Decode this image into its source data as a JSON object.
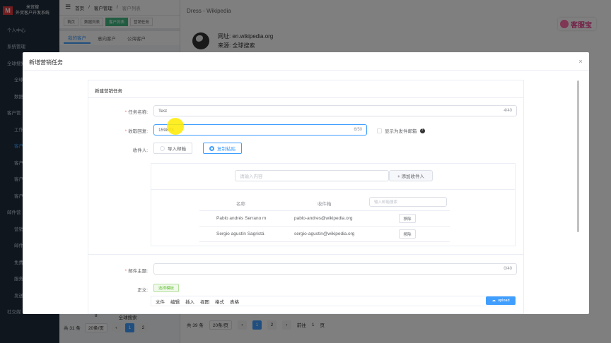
{
  "sidebar": {
    "logo_mark": "M",
    "logo_line1": "米贸搜",
    "logo_line2": "外贸客户开发系统",
    "items": [
      "个人中心",
      "系统管理",
      "全球搜索",
      "全球",
      "数据",
      "客户管",
      "工作",
      "客户",
      "客户",
      "客户",
      "客户",
      "邮件营",
      "营销",
      "邮件",
      "免费",
      "服务",
      "发送",
      "社交媒"
    ]
  },
  "topbar": {
    "breadcrumb": [
      "首页",
      "客户管理",
      "客户列表"
    ]
  },
  "tags": [
    "首页",
    "数据列表",
    "客户列表",
    "营销任务"
  ],
  "subtabs": [
    "我的客户",
    "意向客户",
    "公海客户"
  ],
  "pager_left": {
    "total": "共 31 条",
    "size": "20条/页",
    "pages": [
      "1",
      "2"
    ],
    "row_num": "8",
    "row_text": "全球搜索"
  },
  "drawer": {
    "title": "Dress - Wikipedia",
    "url_line": "网址: en.wikipedia.org",
    "source_line": "来源: 全球搜索"
  },
  "brand": {
    "text": "客服宝"
  },
  "pager_right": {
    "total": "共 39 条",
    "size": "20条/页",
    "pages": [
      "1",
      "2"
    ],
    "goto": "前往",
    "goto_val": "1",
    "page_unit": "页"
  },
  "modal": {
    "title": "新增营销任务",
    "close": "×",
    "card_title": "新建营销任务",
    "task_name": {
      "label": "任务名称:",
      "value": "Test",
      "count": "4/40"
    },
    "reply": {
      "label": "收取回复:",
      "value": "159873",
      "count": "6/50",
      "check_label": "显示为发件邮箱",
      "help": "?"
    },
    "recipients": {
      "label": "收件人:",
      "options": [
        "导入邮箱",
        "复制粘贴"
      ],
      "input_placeholder": "请输入内容",
      "add_button": "+ 添加收件人",
      "headers": [
        "名称",
        "收件箱"
      ],
      "search_placeholder": "输入邮箱搜索",
      "rows": [
        {
          "name": "Pablo andrés Serrano m",
          "email": "pablo-andres@wikipedia.org",
          "action": "移除"
        },
        {
          "name": "Sergio agustín Sagristá",
          "email": "sergio-agustin@wikipedia.org",
          "action": "移除"
        }
      ]
    },
    "subject": {
      "label": "邮件主题:",
      "count": "0/40"
    },
    "body": {
      "label": "正文:",
      "template_button": "选择模板",
      "menu": [
        "文件",
        "编辑",
        "插入",
        "视图",
        "格式",
        "表格"
      ],
      "upload": "upload"
    }
  }
}
